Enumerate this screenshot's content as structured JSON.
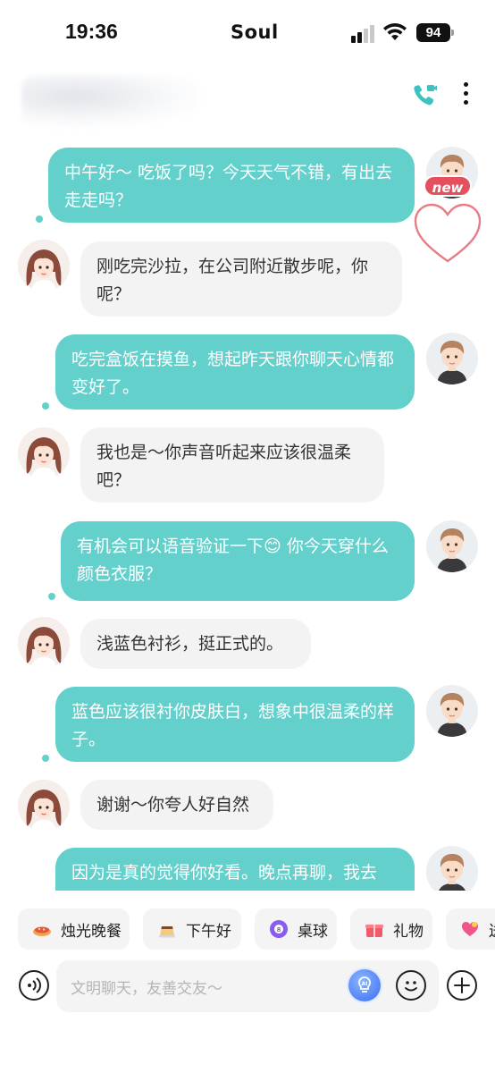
{
  "status_bar": {
    "time": "19:36",
    "app_name": "Soul",
    "battery": "94"
  },
  "header": {
    "call_icon": "video-call-icon",
    "more_icon": "more-vertical-icon"
  },
  "accent_color": "#63d0cc",
  "badge": {
    "new_label": "new",
    "heart_icon": "heart-outline-icon"
  },
  "messages": [
    {
      "side": "out",
      "text": "中午好～ 吃饭了吗？今天天气不错，有出去走走吗？"
    },
    {
      "side": "in",
      "text": "刚吃完沙拉，在公司附近散步呢，你呢？"
    },
    {
      "side": "out",
      "text": "吃完盒饭在摸鱼，想起昨天跟你聊天心情都变好了。"
    },
    {
      "side": "in",
      "text": "我也是～你声音听起来应该很温柔吧？"
    },
    {
      "side": "out",
      "text_before": "有机会可以语音验证一下",
      "emoji": "😊",
      "text_after": " 你今天穿什么颜色衣服？"
    },
    {
      "side": "in",
      "text": "浅蓝色衬衫，挺正式的。"
    },
    {
      "side": "out",
      "text": "蓝色应该很衬你皮肤白，想象中很温柔的样子。"
    },
    {
      "side": "in",
      "text": "谢谢～你夸人好自然"
    },
    {
      "side": "out",
      "text": "因为是真的觉得你好看。晚点再聊，我去"
    }
  ],
  "quick_chips": [
    {
      "label": "烛光晚餐",
      "icon": "dinner-icon"
    },
    {
      "label": "下午好",
      "icon": "pudding-icon"
    },
    {
      "label": "桌球",
      "icon": "billiard-ball-icon"
    },
    {
      "label": "礼物",
      "icon": "gift-icon"
    },
    {
      "label": "送",
      "icon": "heart-gift-icon"
    }
  ],
  "input": {
    "placeholder": "文明聊天，友善交友～"
  }
}
